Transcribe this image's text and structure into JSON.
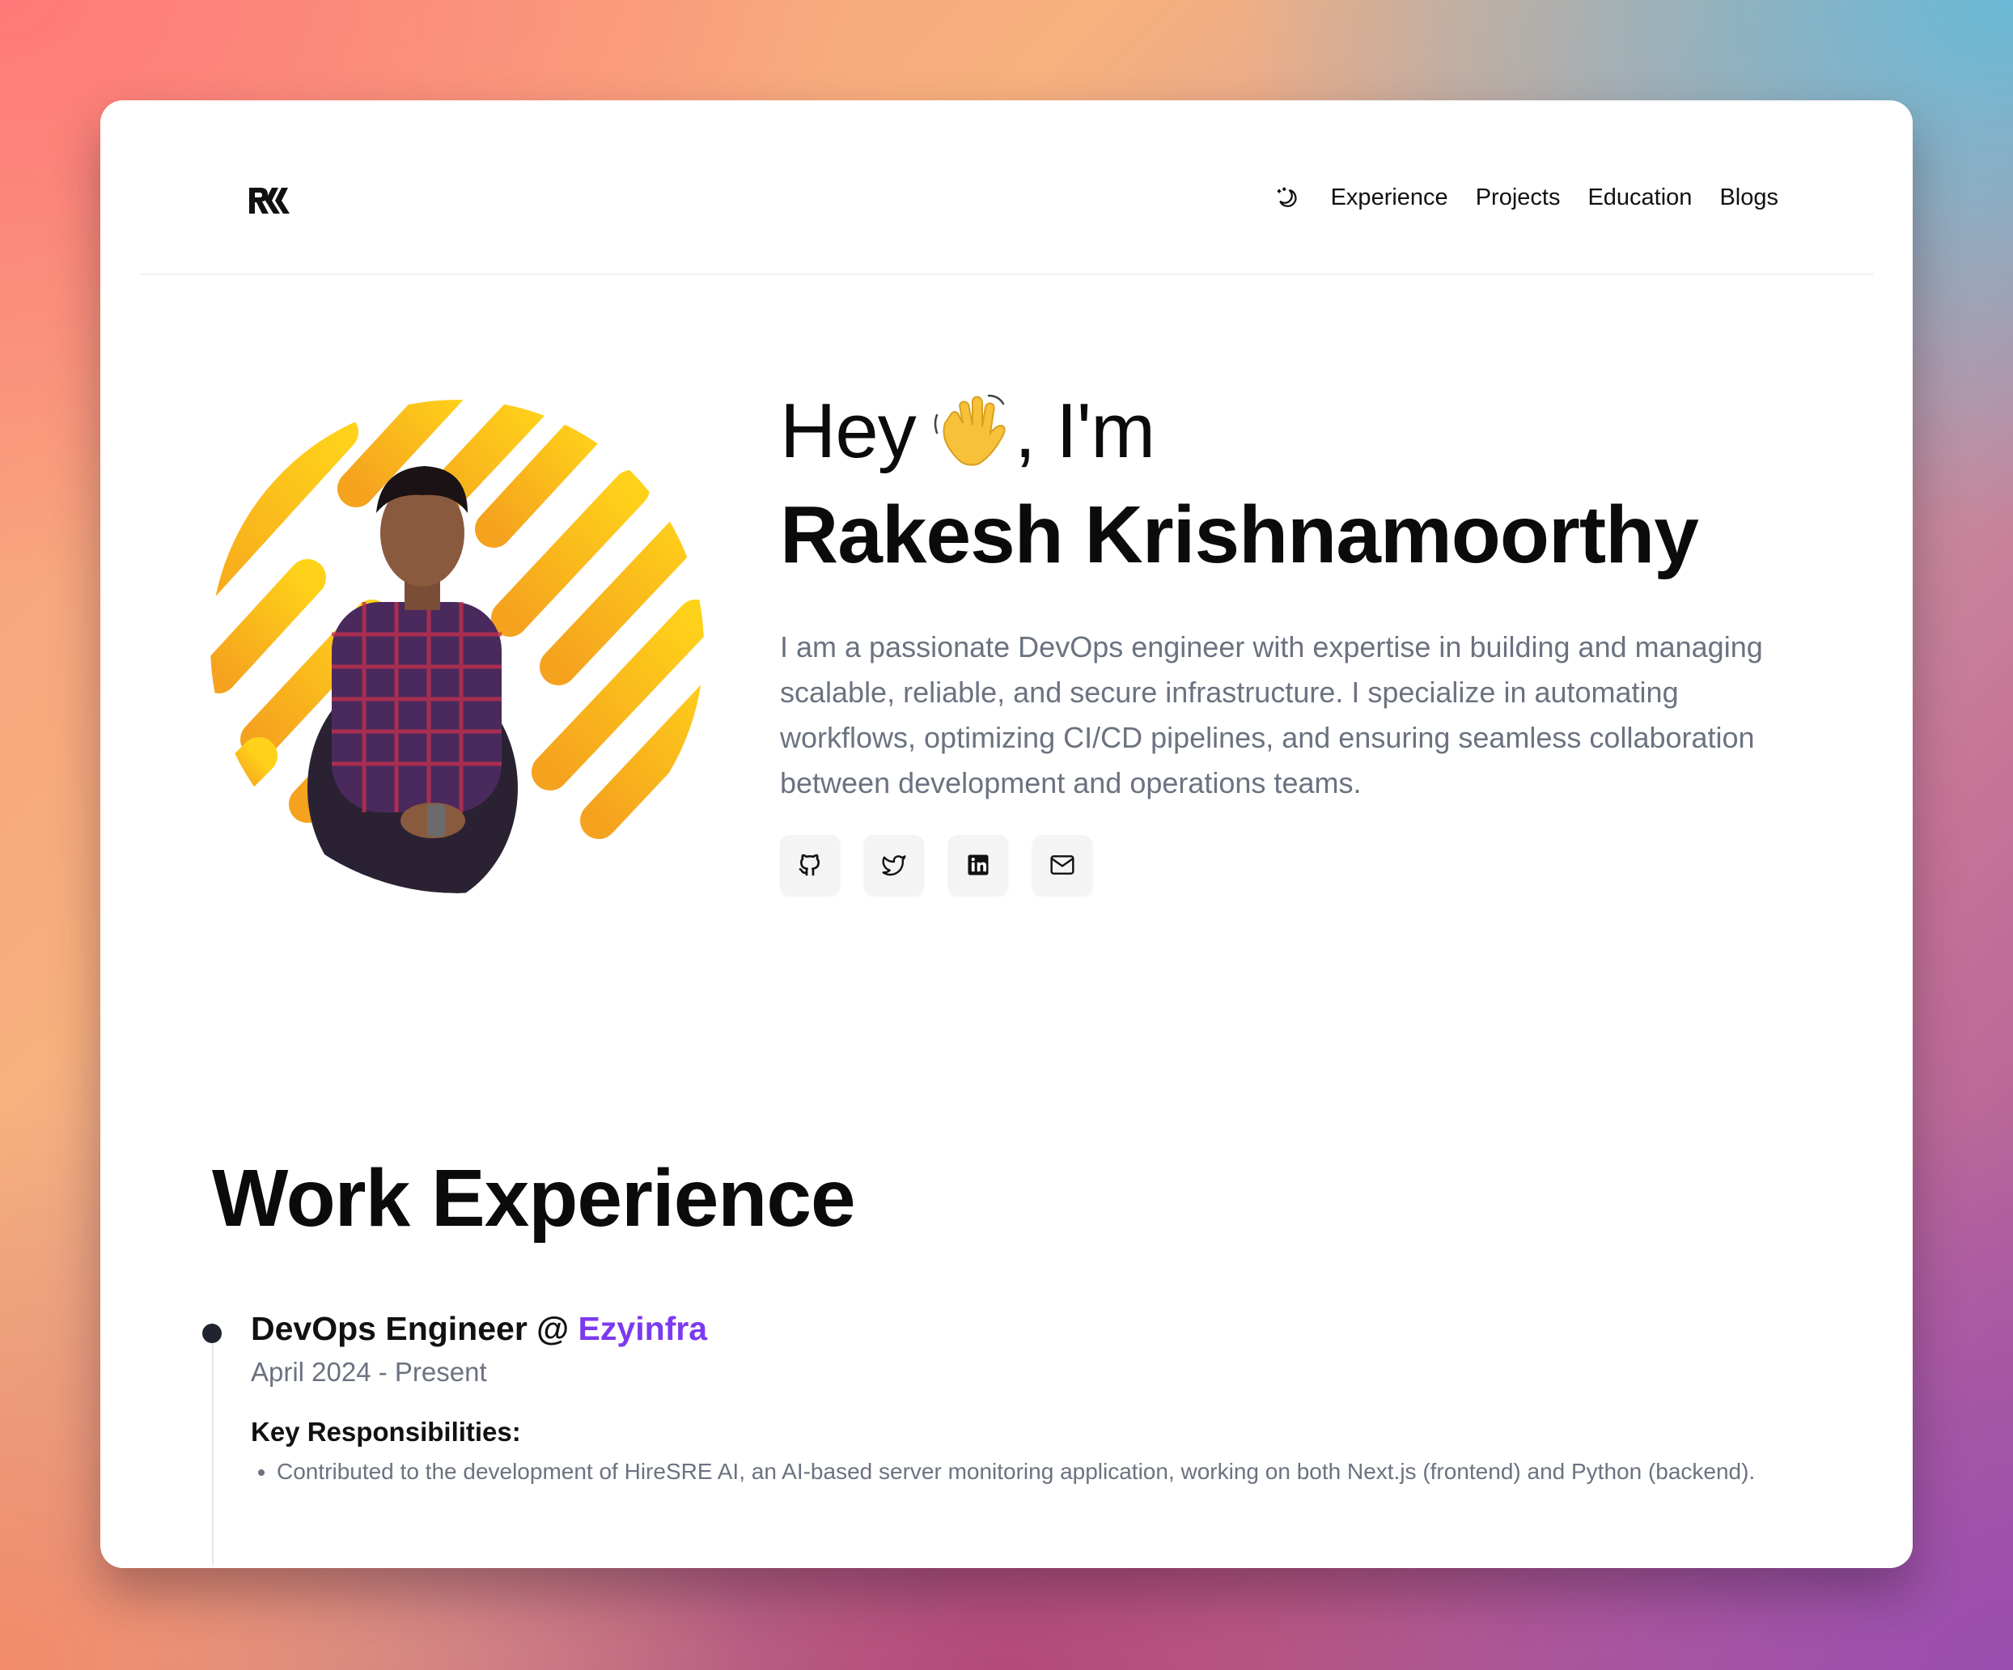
{
  "nav": {
    "logo_text": "RK",
    "theme_toggle_icon": "moon-sun-icon",
    "links": [
      "Experience",
      "Projects",
      "Education",
      "Blogs"
    ]
  },
  "hero": {
    "greeting_prefix": "Hey",
    "greeting_emoji": "waving-hand-icon",
    "greeting_suffix": ", I'm",
    "name": "Rakesh Krishnamoorthy",
    "bio": "I am a passionate DevOps engineer with expertise in building and managing scalable, reliable, and secure infrastructure. I specialize in automating workflows, optimizing CI/CD pipelines, and ensuring seamless collaboration between development and operations teams.",
    "socials": [
      {
        "name": "github",
        "icon": "github-icon"
      },
      {
        "name": "twitter",
        "icon": "twitter-icon"
      },
      {
        "name": "linkedin",
        "icon": "linkedin-icon"
      },
      {
        "name": "email",
        "icon": "mail-icon"
      }
    ]
  },
  "experience": {
    "title": "Work Experience",
    "jobs": [
      {
        "role": "DevOps Engineer @ ",
        "company": "Ezyinfra",
        "dates": "April 2024 - Present",
        "responsibilities_heading": "Key Responsibilities:",
        "responsibilities": [
          "Contributed to the development of HireSRE AI, an AI-based server monitoring application, working on both Next.js (frontend) and Python (backend)."
        ]
      }
    ]
  },
  "colors": {
    "accent": "#7c3aed",
    "muted_text": "#6b7280",
    "avatar_stripes": "#fbbf24"
  }
}
